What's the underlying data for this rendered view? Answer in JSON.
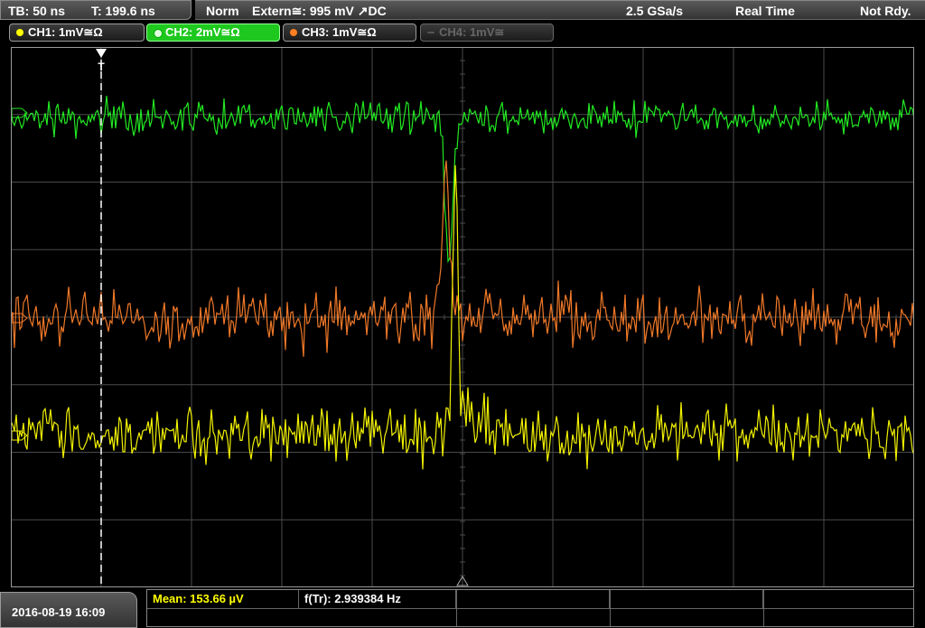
{
  "header": {
    "timebase": "TB: 50 ns",
    "trigger_time": "T: 199.6 ns",
    "trigger_mode": "Norm",
    "trigger_source": "Extern≅: 995 mV ↗DC",
    "sample_rate": "2.5 GSa/s",
    "acq_mode": "Real Time",
    "state": "Not Rdy."
  },
  "channels": [
    {
      "label": "CH1: 1mV≅Ω",
      "color": "#ffff00",
      "active": false,
      "enabled": true
    },
    {
      "label": "CH2: 2mV≅Ω",
      "color": "#00ff00",
      "active": true,
      "enabled": true
    },
    {
      "label": "CH3: 1mV≅Ω",
      "color": "#ff7f20",
      "active": false,
      "enabled": true
    },
    {
      "label": "CH4: 1mV≅",
      "color": "#777777",
      "active": false,
      "enabled": false
    }
  ],
  "footer": {
    "datetime": "2016-08-19 16:09",
    "mean_label": "Mean: 153.66 µV",
    "freq_label": "f(Tr): 2.939384 Hz"
  },
  "colors": {
    "ch1": "#f2f200",
    "ch2": "#22e822",
    "ch3": "#f07828",
    "grid": "#4a4a4a",
    "mean_text": "#ffff00"
  },
  "markers": {
    "trigger_marker_label": "T"
  }
}
